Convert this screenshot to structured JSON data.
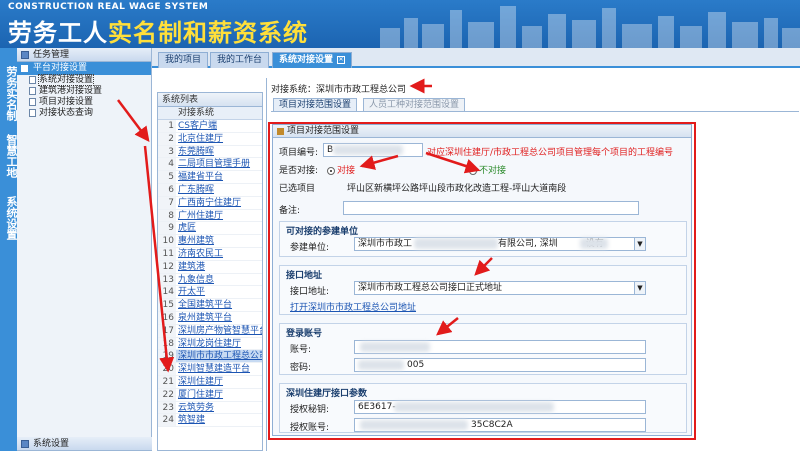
{
  "header": {
    "logo_en": "CONSTRUCTION REAL WAGE SYSTEM",
    "logo_cn_a": "劳务工人",
    "logo_cn_b": "实名制和薪资系统"
  },
  "vtabs": [
    "劳务实名制",
    "智慧工地",
    "系统设置"
  ],
  "sidebar": {
    "section1": "任务管理",
    "section2": "平台对接设置",
    "items": [
      "系统对接设置",
      "建筑港对接设置",
      "项目对接设置",
      "对接状态查询"
    ],
    "bottom": "系统设置"
  },
  "tabs": [
    "我的项目",
    "我的工作台",
    "系统对接设置"
  ],
  "list": {
    "title": "系统列表",
    "col": "对接系统",
    "rows": [
      {
        "n": "1",
        "name": "CS客户端"
      },
      {
        "n": "2",
        "name": "北京住建厅"
      },
      {
        "n": "3",
        "name": "东莞腾晖"
      },
      {
        "n": "4",
        "name": "二局项目管理手册"
      },
      {
        "n": "5",
        "name": "福建省平台"
      },
      {
        "n": "6",
        "name": "广东腾晖"
      },
      {
        "n": "7",
        "name": "广西南宁住建厅"
      },
      {
        "n": "8",
        "name": "广州住建厅"
      },
      {
        "n": "9",
        "name": "虎匠"
      },
      {
        "n": "10",
        "name": "惠州建筑"
      },
      {
        "n": "11",
        "name": "济南农民工"
      },
      {
        "n": "12",
        "name": "建筑港"
      },
      {
        "n": "13",
        "name": "九象信息"
      },
      {
        "n": "14",
        "name": "开太平"
      },
      {
        "n": "15",
        "name": "全国建筑平台"
      },
      {
        "n": "16",
        "name": "泉州建筑平台"
      },
      {
        "n": "17",
        "name": "深圳房产物管智慧平台"
      },
      {
        "n": "18",
        "name": "深圳龙岗住建厅"
      },
      {
        "n": "19",
        "name": "深圳市市政工程总公司"
      },
      {
        "n": "20",
        "name": "深圳智慧建造平台"
      },
      {
        "n": "21",
        "name": "深圳住建厅"
      },
      {
        "n": "22",
        "name": "厦门住建厅"
      },
      {
        "n": "23",
        "name": "云筑劳务"
      },
      {
        "n": "24",
        "name": "筑智建"
      }
    ]
  },
  "main": {
    "system_line": "对接系统：深圳市市政工程总公司",
    "subtabs": [
      "项目对接范围设置",
      "人员工种对接范围设置"
    ],
    "panel_title": "项目对接范围设置",
    "project_code_label": "项目编号:",
    "project_code_value": "B",
    "project_code_note": "对应深圳住建厅/市政工程总公司项目管理每个项目的工程编号",
    "docking_label": "是否对接:",
    "opt_yes": "对接",
    "opt_no": "不对接",
    "project_label": "已选项目",
    "project_value": "坪山区新横坪公路坪山段市政化改造工程-坪山大道南段",
    "remark_label": "备注:",
    "grp1_title": "可对接的参建单位",
    "unit_label": "参建单位:",
    "unit_value_a": "深圳市市政工",
    "unit_value_b": "有限公司, 深圳",
    "unit_value_c": "设有",
    "grp2_title": "接口地址",
    "api_label": "接口地址:",
    "api_value": "深圳市市政工程总公司接口正式地址",
    "api_link": "打开深圳市市政工程总公司地址",
    "grp3_title": "登录账号",
    "acct_label": "账号:",
    "acct_value": "",
    "pwd_label": "密码:",
    "pwd_value": "005",
    "grp4_title": "深圳住建厅接口参数",
    "secret_label": "授权秘钥:",
    "secret_value": "6E3617-",
    "authacct_label": "授权账号:",
    "authacct_value": "35C8C2A"
  }
}
